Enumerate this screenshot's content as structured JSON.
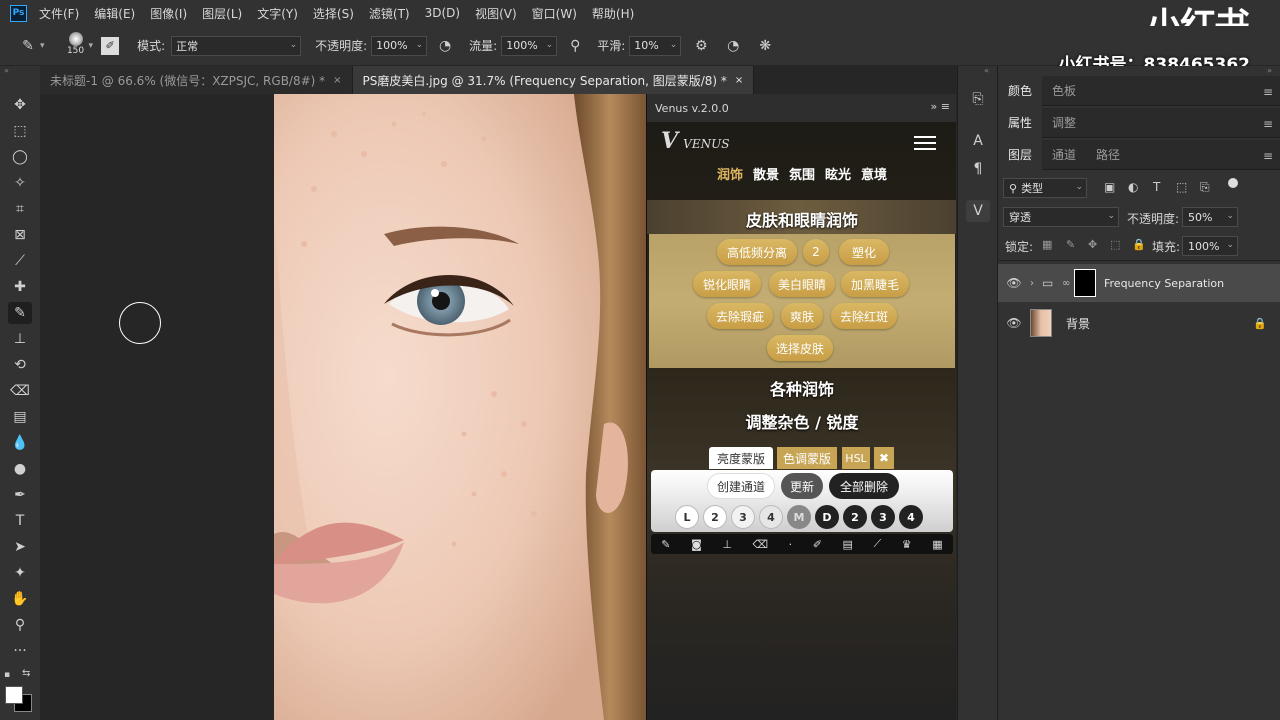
{
  "menubar": {
    "logo": "Ps",
    "items": [
      "文件(F)",
      "编辑(E)",
      "图像(I)",
      "图层(L)",
      "文字(Y)",
      "选择(S)",
      "滤镜(T)",
      "3D(D)",
      "视图(V)",
      "窗口(W)",
      "帮助(H)"
    ],
    "watermark_brand": "小红书"
  },
  "options": {
    "brush_size": "150",
    "mode_label": "模式:",
    "mode_value": "正常",
    "opacity_label": "不透明度:",
    "opacity_value": "100%",
    "flow_label": "流量:",
    "flow_value": "100%",
    "smoothing_label": "平滑:",
    "smoothing_value": "10%",
    "watermark_id": "小红书号：838465362"
  },
  "tabs": [
    {
      "label": "未标题-1 @ 66.6% (微信号：XZPSJC, RGB/8#) *",
      "close": "×"
    },
    {
      "label": "PS磨皮美白.jpg @ 31.7% (Frequency Separation, 图层蒙版/8) *",
      "close": "×"
    }
  ],
  "venus": {
    "version": "Venus v.2.0.0",
    "logo": "VENUS",
    "nav": [
      "润饰",
      "散景",
      "氛围",
      "眩光",
      "意境"
    ],
    "section_skin": "皮肤和眼睛润饰",
    "pills": [
      "高低频分离",
      "2",
      "塑化",
      "锐化眼睛",
      "美白眼睛",
      "加黑睫毛",
      "去除瑕疵",
      "爽肤",
      "去除红斑",
      "选择皮肤"
    ],
    "section_various": "各种润饰",
    "section_adjust": "调整杂色 / 锐度",
    "mask_tabs": [
      "亮度蒙版",
      "色调蒙版",
      "HSL"
    ],
    "mask_close": "✖",
    "btn_create": "创建通道",
    "btn_update": "更新",
    "btn_delete_all": "全部删除",
    "circles": [
      "L",
      "2",
      "3",
      "4",
      "M",
      "D",
      "2",
      "3",
      "4"
    ]
  },
  "panels": {
    "group1": [
      "颜色",
      "色板"
    ],
    "group2": [
      "属性",
      "调整"
    ],
    "group3": [
      "图层",
      "通道",
      "路径"
    ],
    "filter_kind": "类型",
    "blend_mode": "穿透",
    "opacity_label": "不透明度:",
    "opacity_value": "50%",
    "lock_label": "锁定:",
    "fill_label": "填充:",
    "fill_value": "100%",
    "layers": [
      {
        "name": "Frequency Separation"
      },
      {
        "name": "背景"
      }
    ]
  }
}
